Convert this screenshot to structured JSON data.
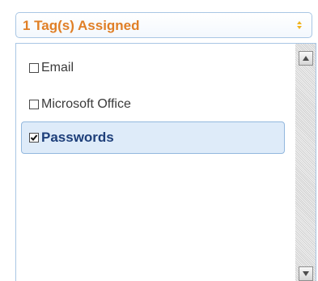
{
  "select": {
    "label": "1 Tag(s) Assigned",
    "icon": "updown-arrows-icon"
  },
  "options": [
    {
      "label": "Email",
      "checked": false
    },
    {
      "label": "Microsoft Office",
      "checked": false
    },
    {
      "label": "Passwords",
      "checked": true
    }
  ],
  "scrollbar": {
    "up_icon": "scroll-up-arrow-icon",
    "down_icon": "scroll-down-arrow-icon"
  },
  "colors": {
    "select_text": "#e07f26",
    "selected_text": "#1e3f7a",
    "selected_bg": "#deebf9",
    "border": "#a9c6e4"
  }
}
